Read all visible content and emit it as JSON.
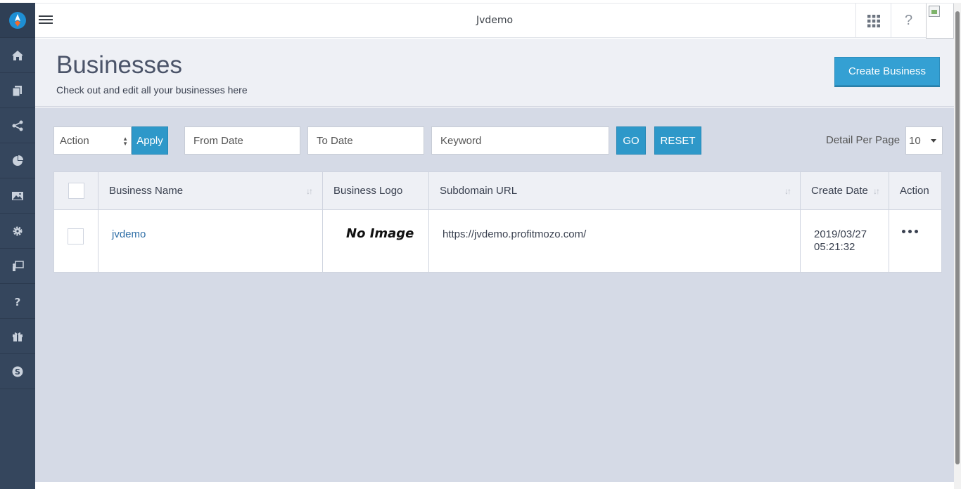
{
  "app": {
    "title": "Jvdemo"
  },
  "sidebar": {
    "items": [
      {
        "name": "home-icon"
      },
      {
        "name": "pages-icon"
      },
      {
        "name": "share-icon"
      },
      {
        "name": "pie-chart-icon"
      },
      {
        "name": "image-icon"
      },
      {
        "name": "gear-icon"
      },
      {
        "name": "presentation-icon"
      },
      {
        "name": "question-icon"
      },
      {
        "name": "gift-icon"
      },
      {
        "name": "skype-icon"
      }
    ]
  },
  "topbar": {
    "help_label": "?"
  },
  "header": {
    "title": "Businesses",
    "subtitle": "Check out and edit all your businesses here",
    "create_label": "Create Business"
  },
  "filters": {
    "action_value": "Action",
    "apply_label": "Apply",
    "from_date_placeholder": "From Date",
    "to_date_placeholder": "To Date",
    "keyword_placeholder": "Keyword",
    "go_label": "GO",
    "reset_label": "RESET",
    "per_page_label": "Detail Per Page",
    "per_page_value": "10"
  },
  "table": {
    "columns": {
      "name": "Business Name",
      "logo": "Business Logo",
      "subdomain": "Subdomain URL",
      "date": "Create Date",
      "action": "Action"
    },
    "rows": [
      {
        "name": "jvdemo",
        "logo": "No Image",
        "subdomain": "https://jvdemo.profitmozo.com/",
        "date_line1": "2019/03/27",
        "date_line2": "05:21:32"
      }
    ]
  },
  "colors": {
    "sidebar": "#35465d",
    "accent": "#2e98c9",
    "content_bg": "#d5dae6",
    "header_bg": "#eef0f5"
  }
}
